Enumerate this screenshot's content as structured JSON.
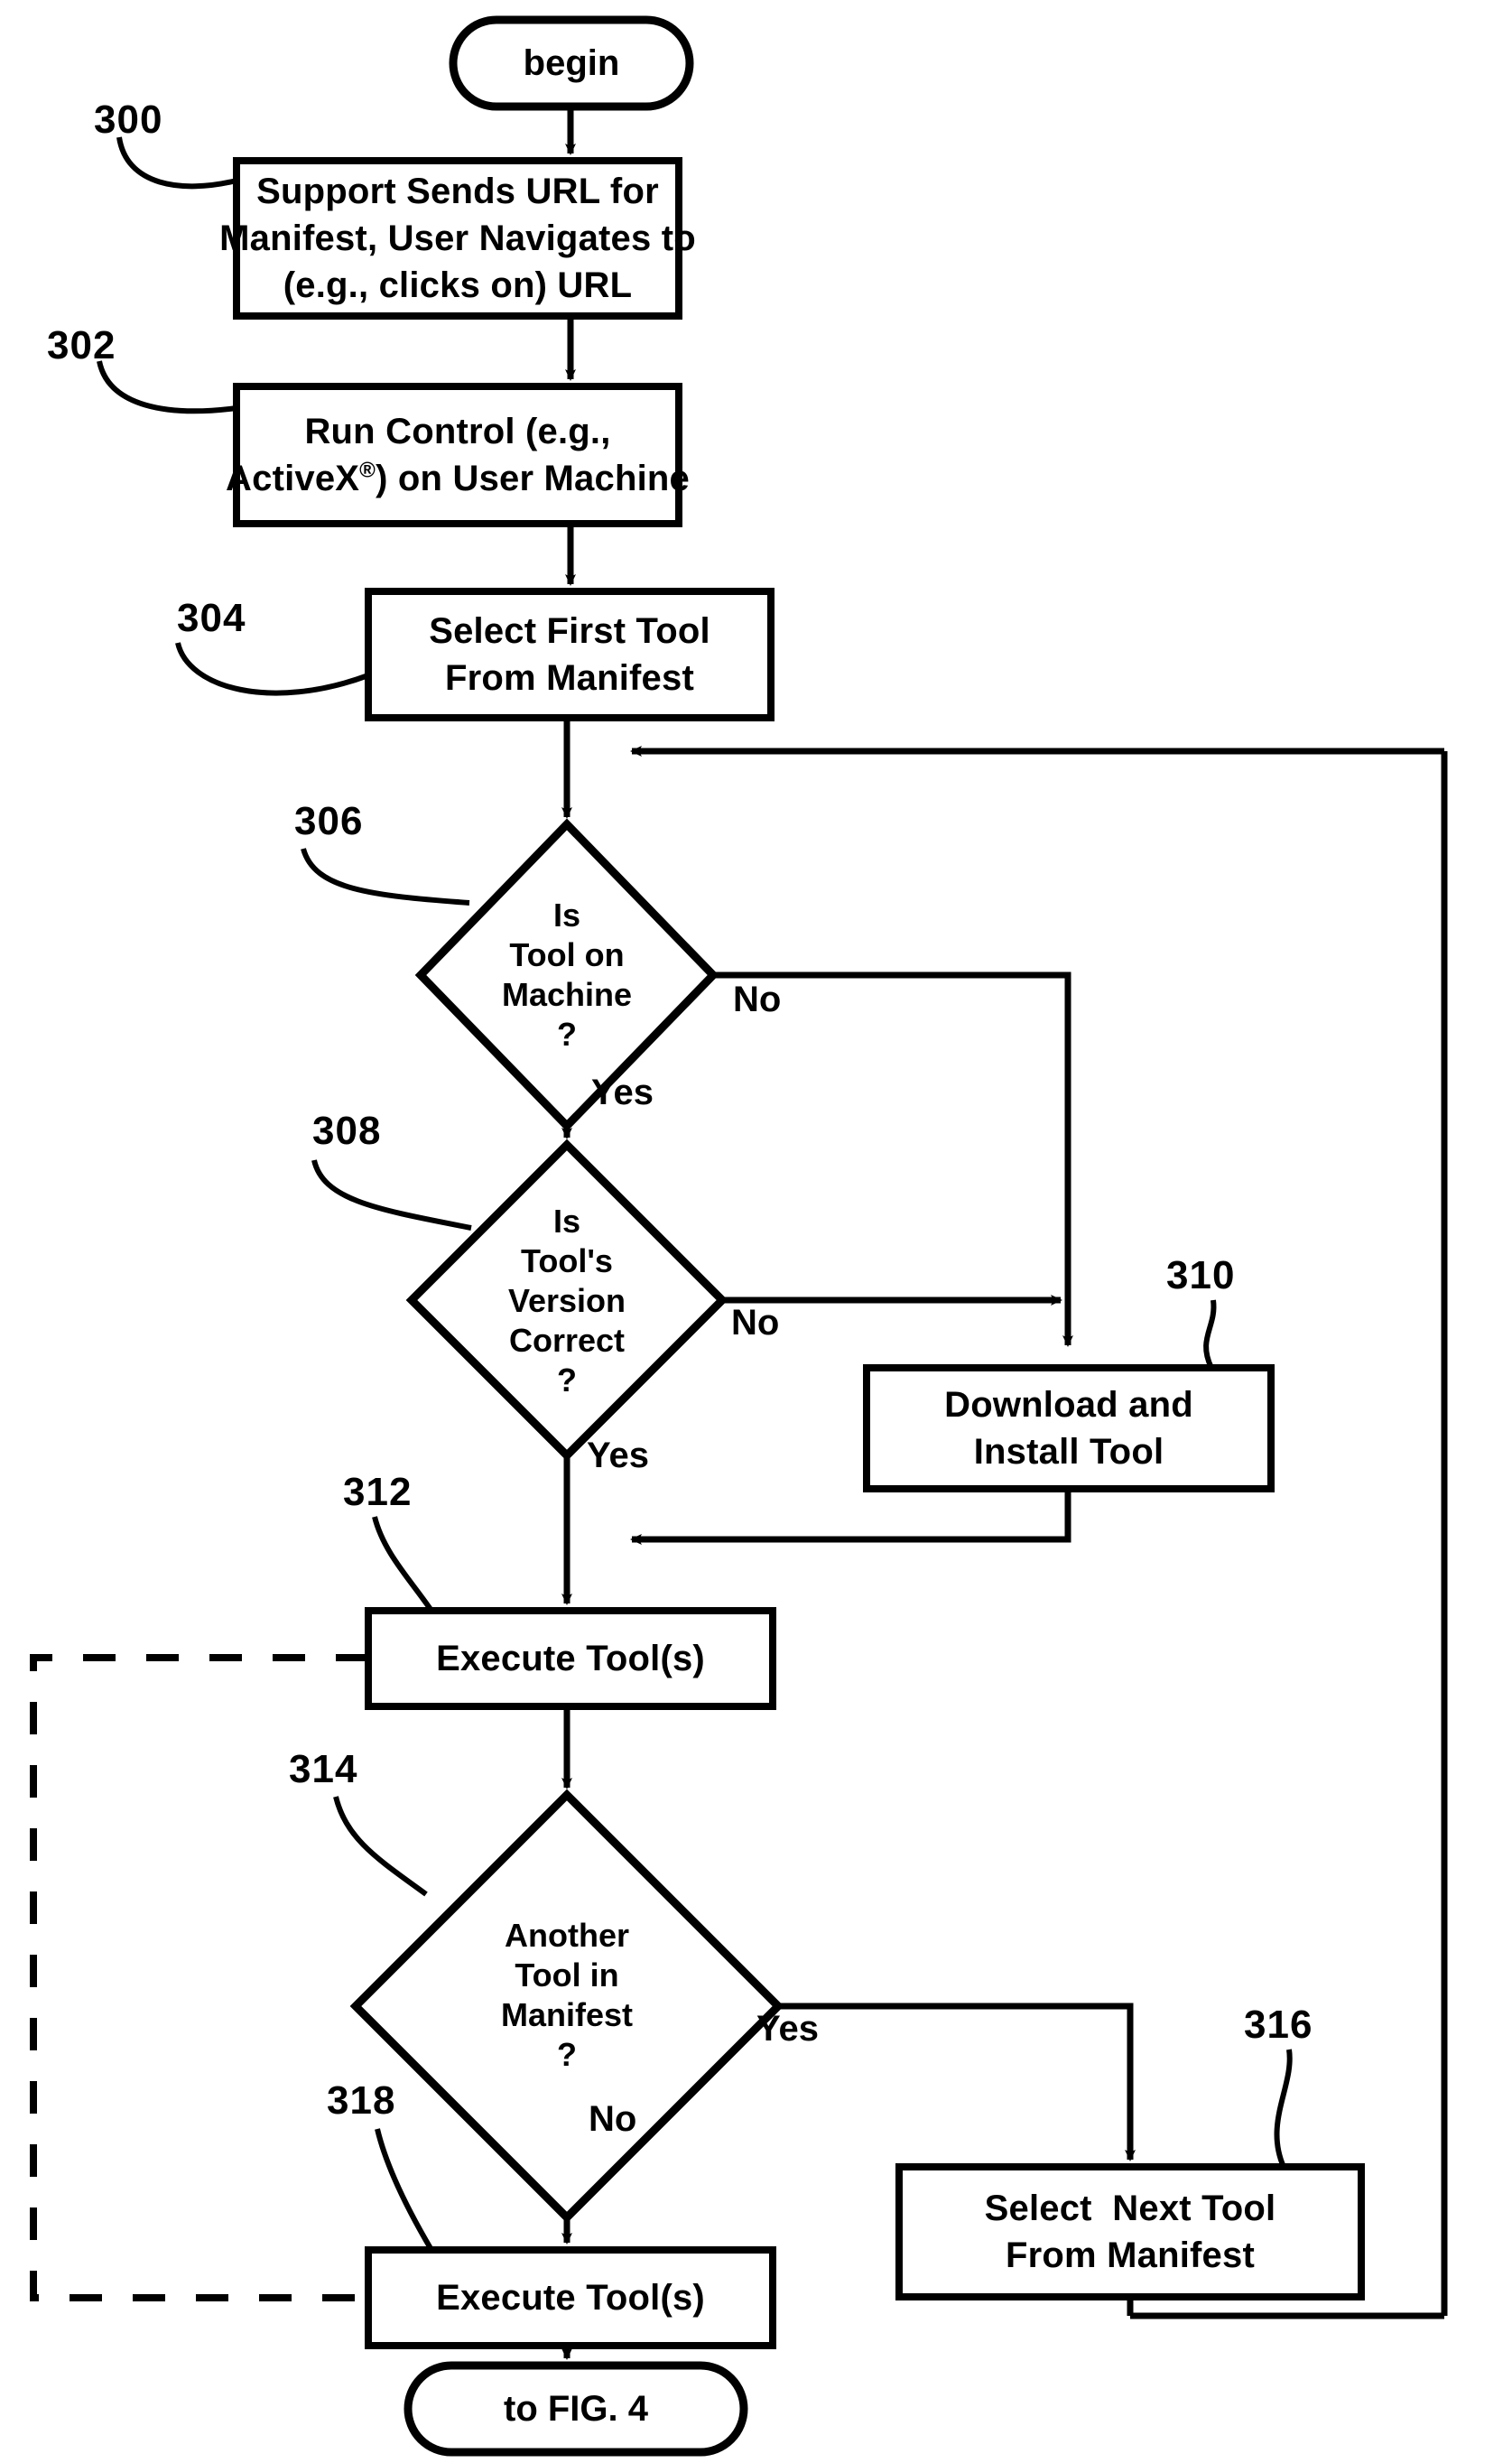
{
  "figure": {
    "title": "FIG. 3 Tool Manifest Execution Flowchart",
    "line_color": "#000000",
    "background_color": "#ffffff"
  },
  "nodes": {
    "begin": {
      "label": "begin",
      "shape": "terminator"
    },
    "n300": {
      "ref": "300",
      "label": "Support Sends URL for\nManifest, User Navigates to\n(e.g., clicks on) URL",
      "shape": "process"
    },
    "n302": {
      "ref": "302",
      "label_line1": "Run Control (e.g.,",
      "label_line2_a": "ActiveX",
      "label_line2_reg": "®",
      "label_line2_b": ") on User Machine",
      "shape": "process"
    },
    "n304": {
      "ref": "304",
      "label": "Select First Tool\nFrom Manifest",
      "shape": "process"
    },
    "n306": {
      "ref": "306",
      "label": "Is\nTool on\nMachine\n?",
      "shape": "decision"
    },
    "n308": {
      "ref": "308",
      "label": "Is\nTool's\nVersion\nCorrect\n?",
      "shape": "decision"
    },
    "n310": {
      "ref": "310",
      "label": "Download and\nInstall Tool",
      "shape": "process"
    },
    "n312": {
      "ref": "312",
      "label": "Execute Tool(s)",
      "shape": "process"
    },
    "n314": {
      "ref": "314",
      "label": "Another\nTool in\nManifest\n?",
      "shape": "decision"
    },
    "n316": {
      "ref": "316",
      "label": "Select  Next Tool\nFrom Manifest",
      "shape": "process"
    },
    "n318": {
      "ref": "318",
      "label": "Execute Tool(s)",
      "shape": "process"
    },
    "end": {
      "label": "to FIG. 4",
      "shape": "terminator"
    }
  },
  "edge_labels": {
    "no_306": "No",
    "yes_306": "Yes",
    "no_308": "No",
    "yes_308": "Yes",
    "yes_314": "Yes",
    "no_314": "No"
  }
}
